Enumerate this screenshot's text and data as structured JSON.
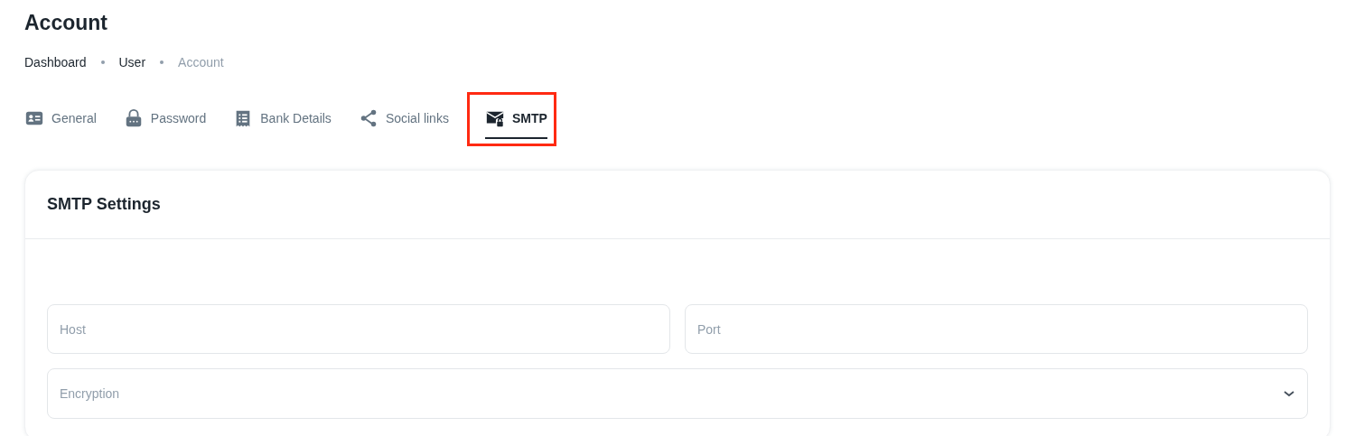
{
  "page_title": "Account",
  "breadcrumbs": [
    {
      "label": "Dashboard",
      "current": false
    },
    {
      "label": "User",
      "current": false
    },
    {
      "label": "Account",
      "current": true
    }
  ],
  "tabs": [
    {
      "label": "General",
      "kind": "id-card",
      "selected": false,
      "highlighted": false
    },
    {
      "label": "Password",
      "kind": "lock",
      "selected": false,
      "highlighted": false
    },
    {
      "label": "Bank Details",
      "kind": "receipt",
      "selected": false,
      "highlighted": false
    },
    {
      "label": "Social links",
      "kind": "share",
      "selected": false,
      "highlighted": false
    },
    {
      "label": "SMTP",
      "kind": "mail-lock",
      "selected": true,
      "highlighted": true
    }
  ],
  "card": {
    "title": "SMTP Settings",
    "fields": [
      {
        "placeholder": "Host",
        "kind": "text"
      },
      {
        "placeholder": "Port",
        "kind": "text"
      },
      {
        "placeholder": "Encryption",
        "kind": "select"
      }
    ]
  }
}
